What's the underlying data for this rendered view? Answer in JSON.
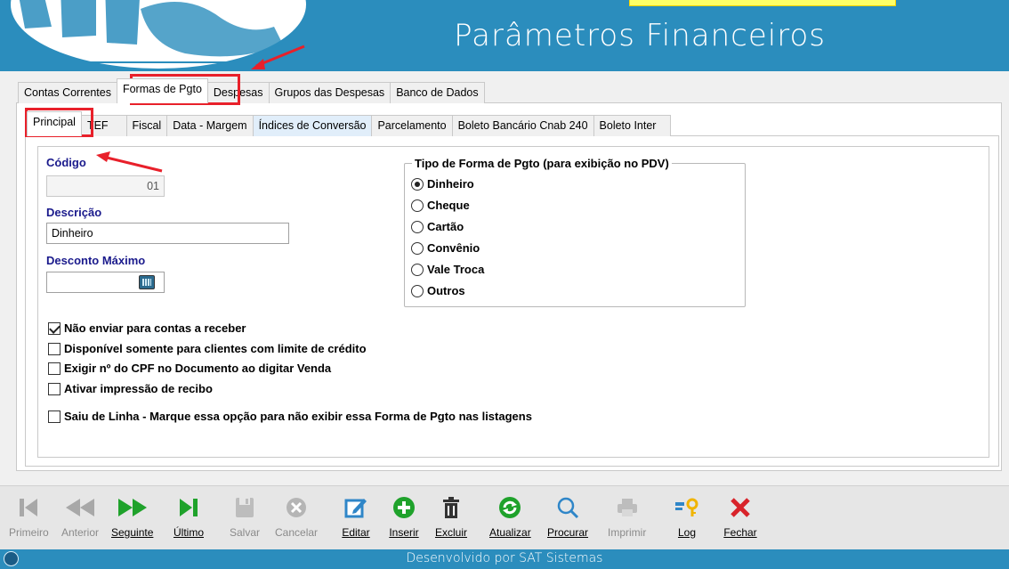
{
  "header": {
    "title": "Parâmetros Financeiros"
  },
  "outer_tabs": [
    "Contas Correntes",
    "Formas de Pgto",
    "Despesas",
    "Grupos das Despesas",
    "Banco de Dados"
  ],
  "inner_tabs": [
    "Principal",
    "TEF",
    "Fiscal",
    "Data - Margem",
    "Índices de Conversão",
    "Parcelamento",
    "Boleto Bancário Cnab 240",
    "Boleto Inter"
  ],
  "form": {
    "codigo_label": "Código",
    "codigo_value": "01",
    "descricao_label": "Descrição",
    "descricao_value": "Dinheiro",
    "desconto_label": "Desconto Máximo",
    "desconto_value": ""
  },
  "tipo_forma": {
    "title": "Tipo de Forma de Pgto (para exibição no PDV)",
    "options": [
      "Dinheiro",
      "Cheque",
      "Cartão",
      "Convênio",
      "Vale Troca",
      "Outros"
    ],
    "selected": "Dinheiro"
  },
  "checkboxes": [
    {
      "label": "Não enviar para contas a receber",
      "checked": true
    },
    {
      "label": "Disponível somente para clientes com limite de crédito",
      "checked": false
    },
    {
      "label": "Exigir nº do CPF no Documento ao digitar Venda",
      "checked": false
    },
    {
      "label": "Ativar impressão de recibo",
      "checked": false
    },
    {
      "label": "Saiu de Linha - Marque essa opção para não exibir essa Forma de Pgto nas listagens",
      "checked": false
    }
  ],
  "toolbar": {
    "primeiro": "Primeiro",
    "anterior": "Anterior",
    "seguinte": "Seguinte",
    "ultimo": "Último",
    "salvar": "Salvar",
    "cancelar": "Cancelar",
    "editar": "Editar",
    "inserir": "Inserir",
    "excluir": "Excluir",
    "atualizar": "Atualizar",
    "procurar": "Procurar",
    "imprimir": "Imprimir",
    "log": "Log",
    "fechar": "Fechar"
  },
  "status": {
    "text": "Desenvolvido por SAT Sistemas"
  },
  "colors": {
    "header_blue": "#2b8dbd",
    "accent_red": "#e8202a",
    "label_blue": "#1a1a8c",
    "green": "#1fa22b"
  }
}
